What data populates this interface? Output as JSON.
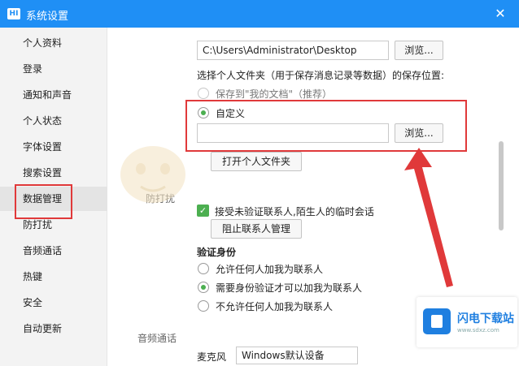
{
  "window": {
    "app_icon_text": "HI",
    "title": "系统设置",
    "close_glyph": "✕",
    "accent_color": "#1f8ff5"
  },
  "sidebar": {
    "items": [
      {
        "label": "个人资料"
      },
      {
        "label": "登录"
      },
      {
        "label": "通知和声音"
      },
      {
        "label": "个人状态"
      },
      {
        "label": "字体设置"
      },
      {
        "label": "搜索设置"
      },
      {
        "label": "数据管理",
        "active": true
      },
      {
        "label": "防打扰"
      },
      {
        "label": "音频通话"
      },
      {
        "label": "热键"
      },
      {
        "label": "安全"
      },
      {
        "label": "自动更新"
      }
    ]
  },
  "data_management": {
    "record_path": "C:\\Users\\Administrator\\Desktop",
    "browse_label": "浏览...",
    "folder_prompt": "选择个人文件夹（用于保存消息记录等数据）的保存位置:",
    "option_my_docs": "保存到\"我的文档\"（推荐）",
    "option_custom": "自定义",
    "custom_path": "",
    "custom_browse_label": "浏览...",
    "open_folder_label": "打开个人文件夹"
  },
  "anti_disturb": {
    "section_title": "防打扰",
    "accept_temp_chat": "接受未验证联系人,陌生人的临时会话",
    "block_manage_label": "阻止联系人管理",
    "verify_title": "验证身份",
    "verify_options": [
      {
        "label": "允许任何人加我为联系人",
        "checked": false
      },
      {
        "label": "需要身份验证才可以加我为联系人",
        "checked": true
      },
      {
        "label": "不允许任何人加我为联系人",
        "checked": false
      }
    ]
  },
  "audio": {
    "section_title": "音频通话",
    "speaker_label": "麦克风",
    "speaker_value": "Windows默认设备"
  },
  "annotation": {
    "highlight_color": "#e0393a"
  },
  "watermark_badge": {
    "name": "闪电下载站",
    "url": "www.sdxz.com"
  }
}
